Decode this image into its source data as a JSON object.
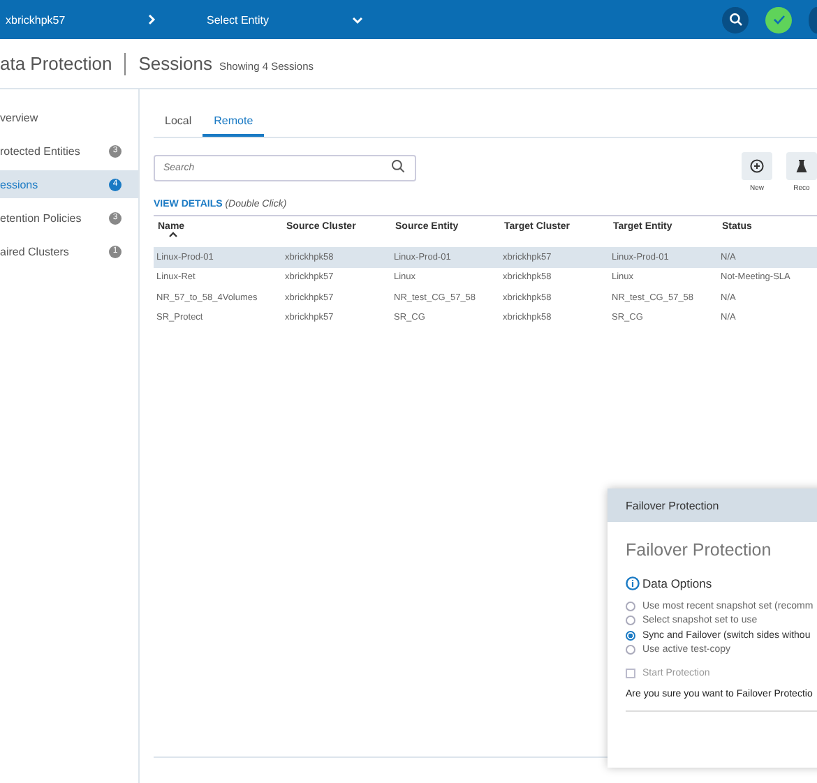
{
  "topbar": {
    "system": "xbrickhpk57",
    "entity_select": "Select Entity"
  },
  "header": {
    "title": "ata Protection",
    "section": "Sessions",
    "count": "Showing 4 Sessions"
  },
  "sidebar": {
    "items": [
      {
        "label": "verview",
        "selected": false
      },
      {
        "label": "rotected Entities",
        "badge": "3",
        "selected": false
      },
      {
        "label": "essions",
        "badge": "4",
        "selected": true
      },
      {
        "label": "etention Policies",
        "badge": "3",
        "selected": false
      },
      {
        "label": "aired Clusters",
        "badge": "1",
        "selected": false
      }
    ]
  },
  "tabs": [
    {
      "label": "Local",
      "selected": false
    },
    {
      "label": "Remote",
      "selected": true
    }
  ],
  "search": {
    "placeholder": "Search"
  },
  "actions": [
    {
      "label": "New",
      "kind": "new"
    },
    {
      "label": "Reco",
      "kind": "recover"
    }
  ],
  "view_details": {
    "link": "VIEW DETAILS",
    "hint": "(Double Click)"
  },
  "table": {
    "columns": [
      {
        "label": "Name",
        "sorted": true
      },
      {
        "label": "Source Cluster",
        "sorted": false
      },
      {
        "label": "Source Entity",
        "sorted": false
      },
      {
        "label": "Target Cluster",
        "sorted": false
      },
      {
        "label": "Target Entity",
        "sorted": false
      },
      {
        "label": "Status",
        "sorted": false
      }
    ],
    "rows": [
      {
        "selected": true,
        "cells": [
          "Linux-Prod-01",
          "xbrickhpk58",
          "Linux-Prod-01",
          "xbrickhpk57",
          "Linux-Prod-01",
          "N/A"
        ]
      },
      {
        "selected": false,
        "cells": [
          "Linux-Ret",
          "xbrickhpk57",
          "Linux",
          "xbrickhpk58",
          "Linux",
          "Not-Meeting-SLA"
        ]
      },
      {
        "selected": false,
        "cells": [
          "NR_57_to_58_4Volumes",
          "xbrickhpk57",
          "NR_test_CG_57_58",
          "xbrickhpk58",
          "NR_test_CG_57_58",
          "N/A"
        ]
      },
      {
        "selected": false,
        "cells": [
          "SR_Protect",
          "xbrickhpk57",
          "SR_CG",
          "xbrickhpk58",
          "SR_CG",
          "N/A"
        ]
      }
    ]
  },
  "dialog": {
    "header": "Failover Protection",
    "title": "Failover Protection",
    "section": "Data Options",
    "options": [
      {
        "label": "Use most recent snapshot set (recomm",
        "selected": false
      },
      {
        "label": "Select snapshot set to use",
        "selected": false
      },
      {
        "label": "Sync and Failover (switch sides withou",
        "selected": true
      },
      {
        "label": "Use active test-copy",
        "selected": false
      }
    ],
    "start_protection": {
      "label": "Start Protection",
      "checked": false,
      "disabled": true
    },
    "question": "Are you sure you want to Failover Protectio"
  }
}
